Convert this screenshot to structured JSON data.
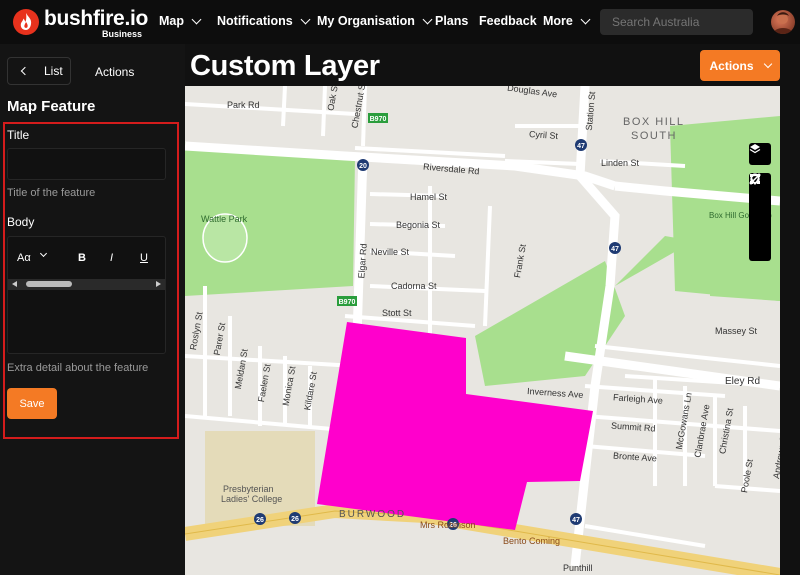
{
  "app": {
    "logo_text": "bushfire.io",
    "logo_sub": "Business"
  },
  "nav": {
    "items": [
      {
        "label": "Map",
        "has_menu": true
      },
      {
        "label": "Notifications",
        "has_menu": true
      },
      {
        "label": "My Organisation",
        "has_menu": true
      },
      {
        "label": "Plans",
        "has_menu": false
      },
      {
        "label": "Feedback",
        "has_menu": false
      },
      {
        "label": "More",
        "has_menu": true
      }
    ],
    "search_placeholder": "Search Australia"
  },
  "sidebar": {
    "tab_list": "List",
    "tab_actions": "Actions",
    "title": "Map Feature",
    "form": {
      "title_label": "Title",
      "title_value": "",
      "title_hint": "Title of the feature",
      "body_label": "Body",
      "font_size_button": "Aα",
      "bold_button": "B",
      "italic_button": "I",
      "underline_button": "U",
      "body_hint": "Extra detail about the feature",
      "save_label": "Save"
    }
  },
  "main": {
    "title": "Custom Layer",
    "actions_label": "Actions"
  },
  "map": {
    "suburb": [
      "BOX HILL",
      "SOUTH"
    ],
    "street_labels": [
      "Park Rd",
      "Oak St",
      "Chestnut St",
      "Elgar Rd",
      "Douglas Ave",
      "Station St",
      "Cyril St",
      "Linden St",
      "Riversdale Rd",
      "Hamel St",
      "Begonia St",
      "Neville St",
      "Cadorna St",
      "Stott St",
      "Frank St",
      "Massey St",
      "Inverness Ave",
      "Farleigh Ave",
      "Summit Rd",
      "Bronte Ave",
      "Eley Rd",
      "McGowans Ln",
      "Clanbrae Ave",
      "Christina St",
      "Poole St",
      "Andrews St",
      "Roslyn St",
      "Parer St",
      "Meldan St",
      "Faelen St",
      "Monica St",
      "Kildare St",
      "BURWOOD",
      "Mrs Robinson",
      "Bento Coming",
      "Punthill",
      "Box Hill Golf Club",
      "Wattle Park",
      "Presbyterian",
      "Ladies' College"
    ],
    "road_shields": [
      "B970",
      "20",
      "47",
      "24",
      "26"
    ],
    "colors": {
      "feature": "#ff00cc",
      "park": "#a8df8e",
      "road_major": "#f0d27a",
      "land": "#e8e6e1"
    }
  }
}
